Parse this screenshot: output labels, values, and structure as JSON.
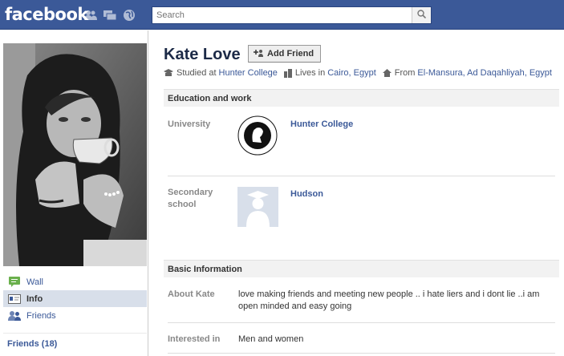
{
  "header": {
    "logo": "facebook",
    "search_placeholder": "Search",
    "jewels": [
      "friend-requests-icon",
      "messages-icon",
      "notifications-icon"
    ]
  },
  "sidebar": {
    "items": [
      {
        "label": "Wall",
        "icon": "wall-icon",
        "active": false
      },
      {
        "label": "Info",
        "icon": "info-icon",
        "active": true
      },
      {
        "label": "Friends",
        "icon": "friends-icon",
        "active": false
      }
    ],
    "friends_link": "Friends (18)"
  },
  "profile": {
    "name": "Kate Love",
    "add_friend_label": "Add Friend",
    "meta": {
      "studied_prefix": "Studied at",
      "studied_link": "Hunter College",
      "lives_prefix": "Lives in",
      "lives_link": "Cairo, Egypt",
      "from_prefix": "From",
      "from_link": "El-Mansura, Ad Daqahliyah, Egypt"
    }
  },
  "education": {
    "heading": "Education and work",
    "entries": [
      {
        "label": "University",
        "name": "Hunter College",
        "logo": "hunter-college-seal"
      },
      {
        "label": "Secondary school",
        "name": "Hudson",
        "logo": "default-school-silhouette"
      }
    ]
  },
  "basic": {
    "heading": "Basic Information",
    "about_label": "About Kate",
    "about_value": "love making friends and meeting new people .. i hate liers and i dont lie ..i am open minded and easy going",
    "interested_label": "Interested in",
    "interested_value": "Men and women"
  },
  "colors": {
    "brand": "#3b5998",
    "link": "#3b5998",
    "active_nav": "#d8dfea"
  }
}
